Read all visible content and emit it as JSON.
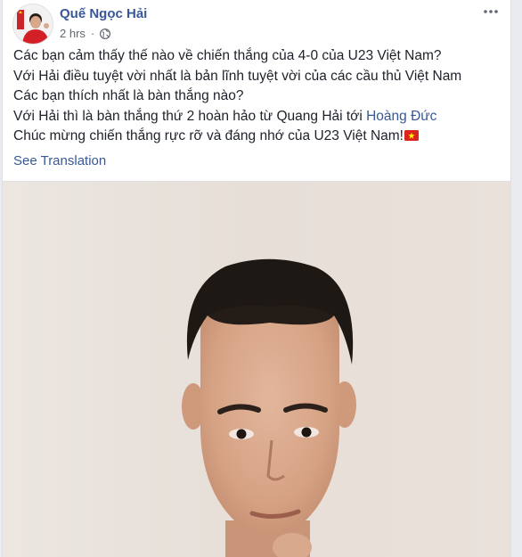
{
  "post": {
    "author_name": "Quế Ngọc Hải",
    "timestamp": "2 hrs",
    "separator": "·",
    "privacy_icon": "globe-icon",
    "more_icon": "more-options-icon",
    "body": {
      "line1": "Các bạn cảm thấy thế nào về chiến thắng của 4-0 của U23 Việt Nam?",
      "line2": "Với Hải điều tuyệt vời nhất là bản lĩnh tuyệt vời của các cầu thủ Việt Nam",
      "line3": "Các bạn thích nhất là bàn thắng nào?",
      "line4_prefix": "Với Hải thì là bàn thắng thứ 2 hoàn hảo từ Quang Hải tới ",
      "line4_mention": "Hoàng Đức",
      "line5": "Chúc mừng chiến thắng rực rỡ và đáng nhớ của U23 Việt Nam!",
      "flag_icon": "vietnam-flag-icon"
    },
    "see_translation": "See Translation",
    "media": {
      "type": "photo",
      "subject": "selfie-photo"
    }
  },
  "colors": {
    "link": "#385898",
    "text": "#1d2129",
    "meta": "#616770",
    "flag_red": "#da251d",
    "flag_star": "#ffff00",
    "photo_wall": "#e9e2dc"
  }
}
